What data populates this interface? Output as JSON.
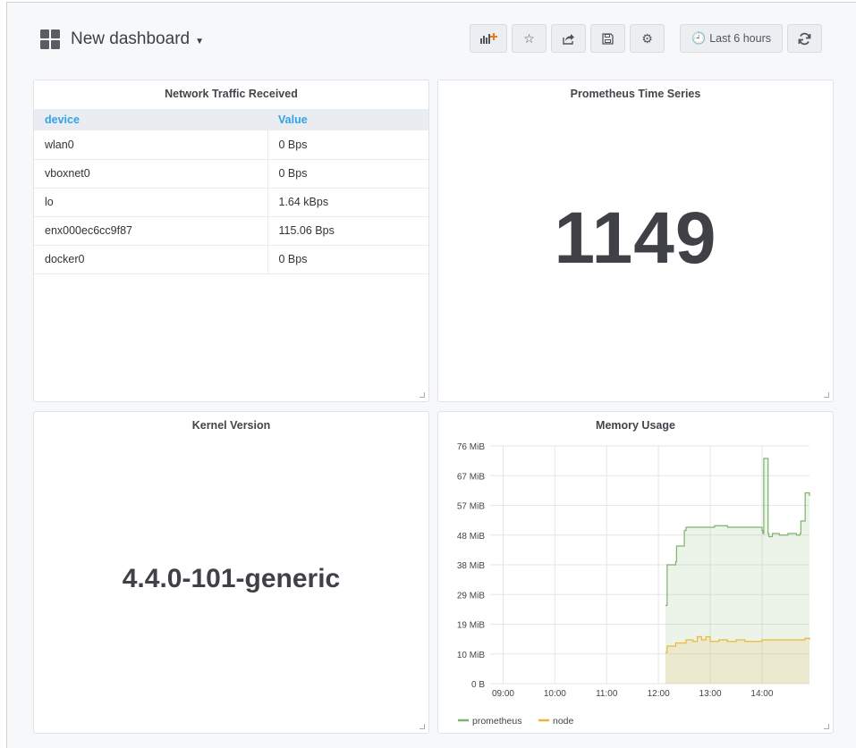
{
  "header": {
    "title": "New dashboard",
    "time_range": "Last 6 hours",
    "buttons": [
      {
        "icon": "add-panel-icon"
      },
      {
        "icon": "star-icon"
      },
      {
        "icon": "share-icon"
      },
      {
        "icon": "save-icon"
      },
      {
        "icon": "gear-icon"
      }
    ]
  },
  "panels": {
    "network": {
      "title": "Network Traffic Received",
      "columns": [
        "device",
        "Value"
      ],
      "rows": [
        [
          "wlan0",
          "0 Bps"
        ],
        [
          "vboxnet0",
          "0 Bps"
        ],
        [
          "lo",
          "1.64 kBps"
        ],
        [
          "enx000ec6cc9f87",
          "115.06 Bps"
        ],
        [
          "docker0",
          "0 Bps"
        ]
      ]
    },
    "prometheus": {
      "title": "Prometheus Time Series",
      "value": "1149"
    },
    "kernel": {
      "title": "Kernel Version",
      "value": "4.4.0-101-generic"
    },
    "memory": {
      "title": "Memory Usage"
    }
  },
  "chart_data": {
    "type": "area",
    "title": "Memory Usage",
    "xlabel": "",
    "ylabel": "",
    "x_ticks": [
      "09:00",
      "10:00",
      "11:00",
      "12:00",
      "13:00",
      "14:00"
    ],
    "y_ticks": [
      "0 B",
      "10 MiB",
      "19 MiB",
      "29 MiB",
      "38 MiB",
      "48 MiB",
      "57 MiB",
      "67 MiB",
      "76 MiB"
    ],
    "ylim_mib": [
      0,
      76
    ],
    "xlim": [
      "08:45",
      "14:55"
    ],
    "grid": true,
    "legend": "bottom",
    "series": [
      {
        "name": "prometheus",
        "color": "#7eb26d",
        "x": [
          "12:08",
          "12:10",
          "12:20",
          "12:21",
          "12:30",
          "12:32",
          "12:45",
          "13:00",
          "13:05",
          "13:20",
          "13:40",
          "14:00",
          "14:01",
          "14:02",
          "14:06",
          "14:07",
          "14:08",
          "14:12",
          "14:20",
          "14:30",
          "14:40",
          "14:44",
          "14:45",
          "14:49",
          "14:50",
          "14:55"
        ],
        "y": [
          25,
          38,
          39,
          44,
          49,
          50,
          50,
          50,
          50.5,
          50,
          50,
          49,
          48,
          72,
          72,
          48,
          47,
          48,
          47.5,
          48,
          47.5,
          48,
          52,
          52,
          61,
          60
        ]
      },
      {
        "name": "node",
        "color": "#eab839",
        "x": [
          "12:08",
          "12:10",
          "12:20",
          "12:30",
          "12:32",
          "12:40",
          "12:45",
          "12:50",
          "12:55",
          "13:00",
          "13:10",
          "13:20",
          "13:30",
          "13:40",
          "14:00",
          "14:20",
          "14:40",
          "14:50",
          "14:55"
        ],
        "y": [
          10,
          12,
          13,
          13,
          14,
          13.5,
          15,
          14,
          15,
          13.5,
          14,
          13.5,
          14,
          13.5,
          14,
          14,
          14,
          14.5,
          14
        ]
      }
    ]
  }
}
